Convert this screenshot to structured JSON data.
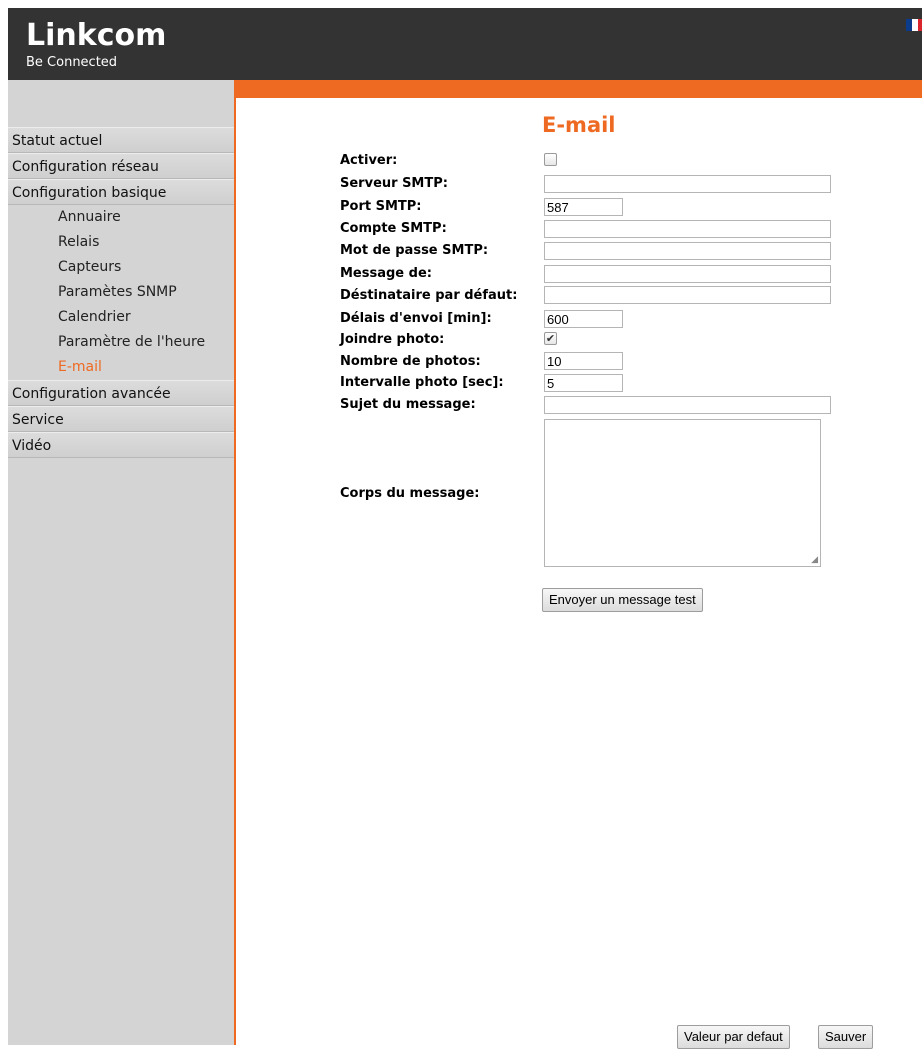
{
  "header": {
    "brand": "Linkcom",
    "tagline": "Be Connected",
    "flag_icon": "french-flag-icon",
    "colors": {
      "header_bg": "#333333",
      "accent": "#ee6a22"
    }
  },
  "sidebar": {
    "items": [
      {
        "label": "Statut actuel",
        "level": 0
      },
      {
        "label": "Configuration réseau",
        "level": 0
      },
      {
        "label": "Configuration basique",
        "level": 0
      },
      {
        "label": "Annuaire",
        "level": 1
      },
      {
        "label": "Relais",
        "level": 1
      },
      {
        "label": "Capteurs",
        "level": 1
      },
      {
        "label": "Paramètes SNMP",
        "level": 1
      },
      {
        "label": "Calendrier",
        "level": 1
      },
      {
        "label": "Paramètre de l'heure",
        "level": 1
      },
      {
        "label": "E-mail",
        "level": 1,
        "active": true
      },
      {
        "label": "Configuration avancée",
        "level": 0
      },
      {
        "label": "Service",
        "level": 0
      },
      {
        "label": "Vidéo",
        "level": 0
      }
    ]
  },
  "main": {
    "title": "E-mail",
    "fields": {
      "activer": {
        "label": "Activer:",
        "checked": false
      },
      "serveur_smtp": {
        "label": "Serveur SMTP:",
        "value": ""
      },
      "port_smtp": {
        "label": "Port SMTP:",
        "value": "587"
      },
      "compte_smtp": {
        "label": "Compte SMTP:",
        "value": ""
      },
      "mot_de_passe": {
        "label": "Mot de passe SMTP:",
        "value": ""
      },
      "message_de": {
        "label": "Message de:",
        "value": ""
      },
      "destinataire": {
        "label": "Déstinataire par défaut:",
        "value": ""
      },
      "delais_envoi": {
        "label": "Délais d'envoi [min]:",
        "value": "600"
      },
      "joindre_photo": {
        "label": "Joindre photo:",
        "checked": true
      },
      "nombre_photos": {
        "label": "Nombre de photos:",
        "value": "10"
      },
      "intervalle_photo": {
        "label": "Intervalle photo [sec]:",
        "value": "5"
      },
      "sujet": {
        "label": "Sujet du message:",
        "value": ""
      },
      "corps": {
        "label": "Corps du message:",
        "value": ""
      }
    },
    "test_button": "Envoyer un message test",
    "default_button": "Valeur par defaut",
    "save_button": "Sauver"
  }
}
